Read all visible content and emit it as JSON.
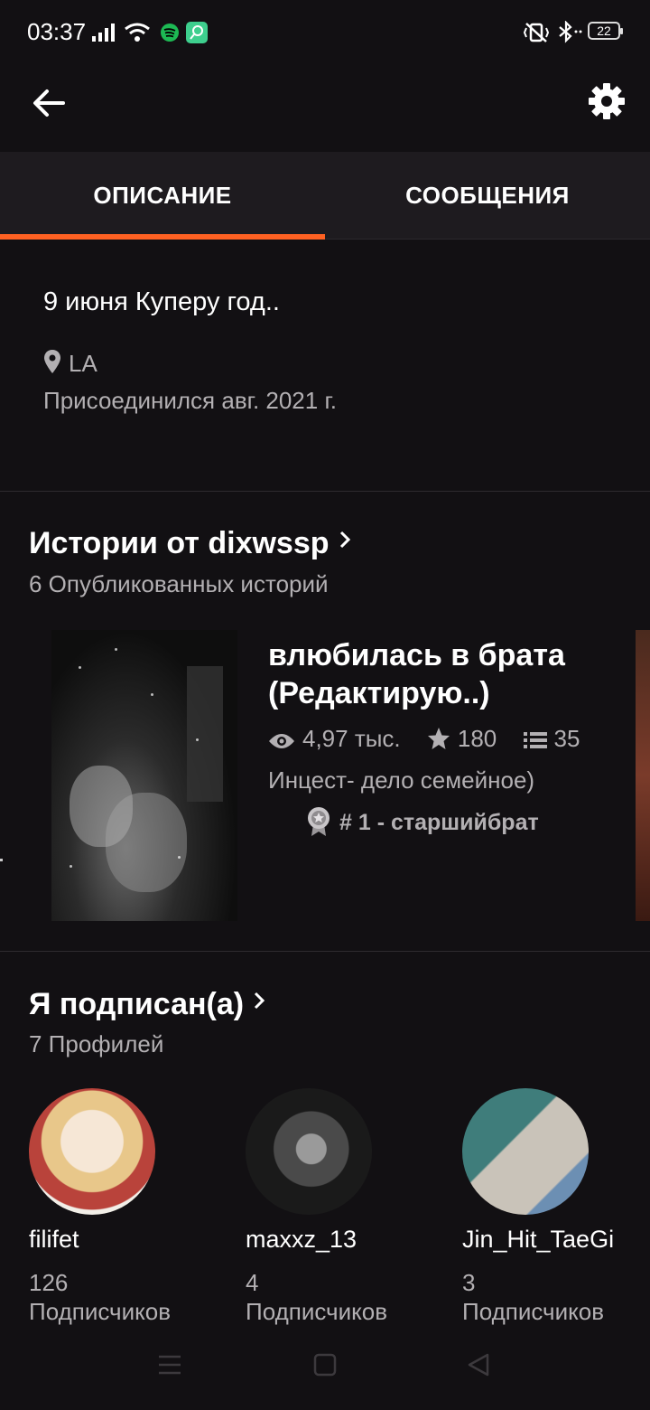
{
  "status_bar": {
    "time": "03:37",
    "battery": "22"
  },
  "tabs": [
    {
      "label": "ОПИСАНИЕ"
    },
    {
      "label": "СООБЩЕНИЯ"
    }
  ],
  "colors": {
    "accent": "#ff6122",
    "background": "#121013",
    "muted_text": "#b3b0b3"
  },
  "about": {
    "description": "9 июня Куперу год..",
    "location": "LA",
    "joined": "Присоединился авг. 2021 г."
  },
  "stories_section": {
    "title": "Истории от dixwssp",
    "subtitle": "6 Опубликованных историй",
    "story": {
      "title": "влюбилась в брата (Редактирую..)",
      "reads": "4,97 тыс.",
      "votes": "180",
      "parts": "35",
      "tagline": "Инцест- дело семейное)",
      "rank": "# 1 - старшийбрат"
    }
  },
  "following_section": {
    "title": "Я подписан(а)",
    "subtitle": "7 Профилей",
    "profiles": [
      {
        "name": "filifet",
        "count": "126",
        "label": "Подписчиков"
      },
      {
        "name": "maxxz_13",
        "count": "4",
        "label": "Подписчиков"
      },
      {
        "name": "Jin_Hit_TaeGi",
        "count": "3",
        "label": "Подписчиков"
      }
    ]
  },
  "icons": {
    "back": "arrow-left-icon",
    "settings": "gear-icon",
    "location": "map-pin-icon",
    "reads": "eye-icon",
    "votes": "star-icon",
    "parts": "list-icon",
    "rank": "medal-icon"
  }
}
